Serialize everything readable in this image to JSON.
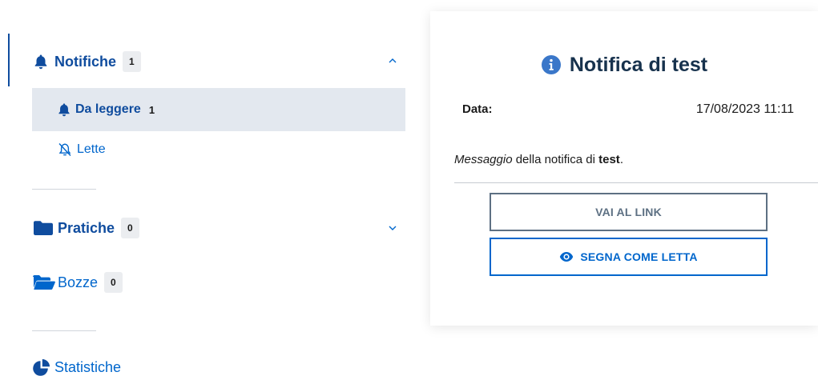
{
  "sidebar": {
    "notifiche": {
      "label": "Notifiche",
      "count": "1"
    },
    "da_leggere": {
      "label": "Da leggere",
      "count": "1"
    },
    "lette": {
      "label": "Lette"
    },
    "pratiche": {
      "label": "Pratiche",
      "count": "0"
    },
    "bozze": {
      "label": "Bozze",
      "count": "0"
    },
    "statistiche": {
      "label": "Statistiche"
    }
  },
  "card": {
    "title": "Notifica di test",
    "date_label": "Data:",
    "date_value": "17/08/2023 11:11",
    "message": {
      "part1": "Messaggio",
      "part2": " della notifica di ",
      "part3": "test",
      "part4": "."
    },
    "link_button": "VAI AL LINK",
    "read_button": "SEGNA COME LETTA"
  },
  "colors": {
    "primary": "#0066cc",
    "primary_dark": "#0f4c9e",
    "active_bg": "#e3e8ef",
    "badge_bg": "#ebedf0",
    "secondary_text": "#5d7083"
  },
  "icons": {
    "notifiche": "bell-icon",
    "da_leggere": "bell-icon",
    "lette": "bell-slash-icon",
    "pratiche": "folder-icon",
    "bozze": "folder-open-icon",
    "statistiche": "chart-pie-icon",
    "title": "info-circle-icon",
    "read_button": "eye-icon"
  }
}
